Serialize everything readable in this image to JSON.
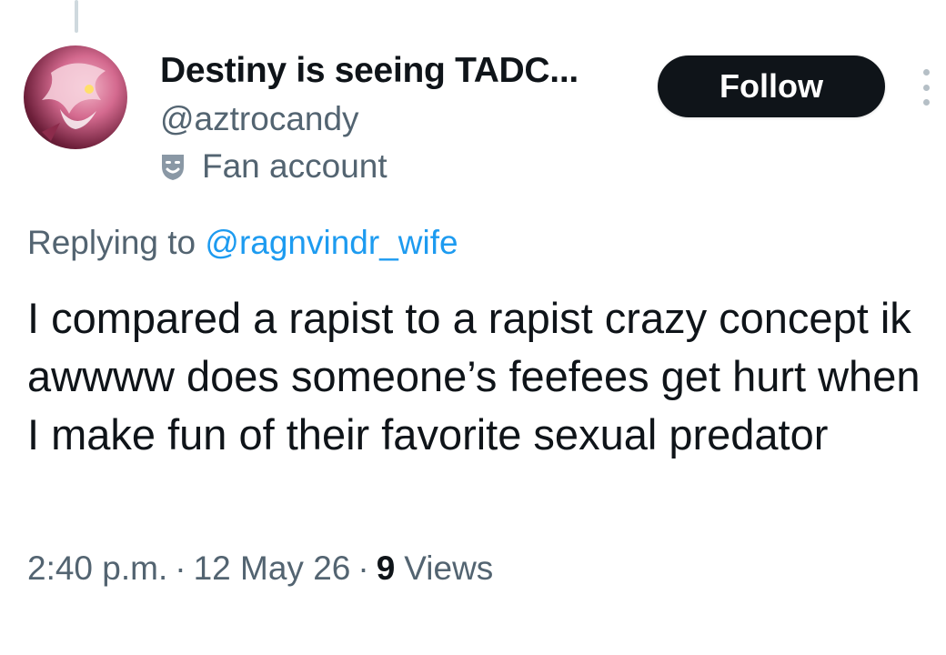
{
  "tweet": {
    "author": {
      "display_name": "Destiny is seeing TADC...",
      "handle": "@aztrocandy",
      "label": "Fan account",
      "label_icon": "theater-masks-icon"
    },
    "follow_label": "Follow",
    "more_icon": "more-vertical-icon",
    "reply_prefix": "Replying to",
    "reply_to": "@ragnvindr_wife",
    "text": "I compared a rapist to a rapist crazy concept ik awwww does someone’s feefees get hurt when I make fun of their favorite sexual predator",
    "time": "2:40 p.m.",
    "date": "12 May 26",
    "separator": "·",
    "views_count": "9",
    "views_label": "Views"
  },
  "colors": {
    "text_primary": "#0f1419",
    "text_secondary": "#536471",
    "link": "#1d9bf0",
    "button_bg": "#0f1419",
    "thread_line": "#cfd9de"
  }
}
